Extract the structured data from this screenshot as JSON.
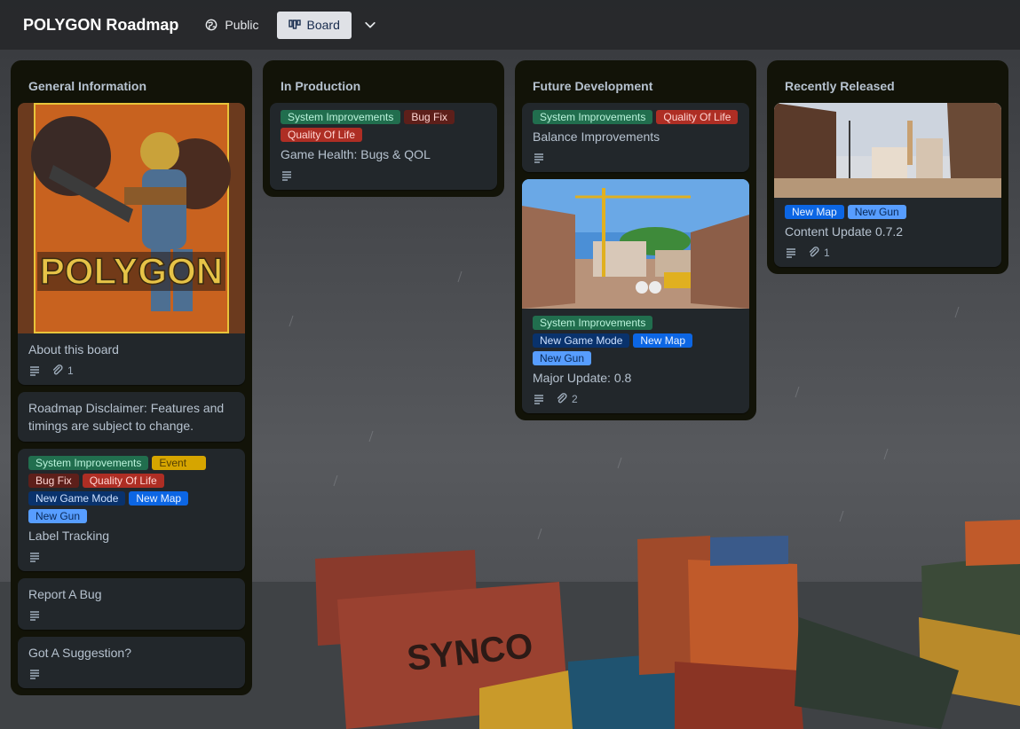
{
  "header": {
    "board_title": "POLYGON Roadmap",
    "visibility": "Public",
    "view_label": "Board"
  },
  "lists": [
    {
      "title": "General Information",
      "cards": [
        {
          "title": "About this board",
          "cover_text": "POLYGON",
          "has_description": true,
          "attachments": "1"
        },
        {
          "title": "Roadmap Disclaimer: Features and timings are subject to change."
        },
        {
          "labels": [
            "System Improvements",
            "Event",
            "Bug Fix",
            "Quality Of Life",
            "New Game Mode",
            "New Map",
            "New Gun"
          ],
          "title": "Label Tracking",
          "has_description": true
        },
        {
          "title": "Report A Bug",
          "has_description": true
        },
        {
          "title": "Got A Suggestion?",
          "has_description": true
        }
      ]
    },
    {
      "title": "In Production",
      "cards": [
        {
          "labels": [
            "System Improvements",
            "Bug Fix",
            "Quality Of Life"
          ],
          "title": "Game Health: Bugs & QOL",
          "has_description": true
        }
      ]
    },
    {
      "title": "Future Development",
      "cards": [
        {
          "labels": [
            "System Improvements",
            "Quality Of Life"
          ],
          "title": "Balance Improvements",
          "has_description": true
        },
        {
          "labels": [
            "System Improvements",
            "New Game Mode",
            "New Map",
            "New Gun"
          ],
          "title": "Major Update: 0.8",
          "has_description": true,
          "attachments": "2"
        }
      ]
    },
    {
      "title": "Recently Released",
      "cards": [
        {
          "labels": [
            "New Map",
            "New Gun"
          ],
          "title": "Content Update 0.7.2",
          "has_description": true,
          "attachments": "1"
        }
      ]
    }
  ],
  "label_colors": {
    "System Improvements": "#216e4e",
    "Event": "#d6a500",
    "Bug Fix": "#5d1f1a",
    "Quality Of Life": "#ae2e24",
    "New Game Mode": "#09326c",
    "New Map": "#0c66e4",
    "New Gun": "#579dff"
  },
  "icons": {
    "visibility": "globe-icon",
    "view": "board-view-icon",
    "dropdown": "chevron-down-icon",
    "description": "description-icon",
    "attachment": "paperclip-icon"
  }
}
